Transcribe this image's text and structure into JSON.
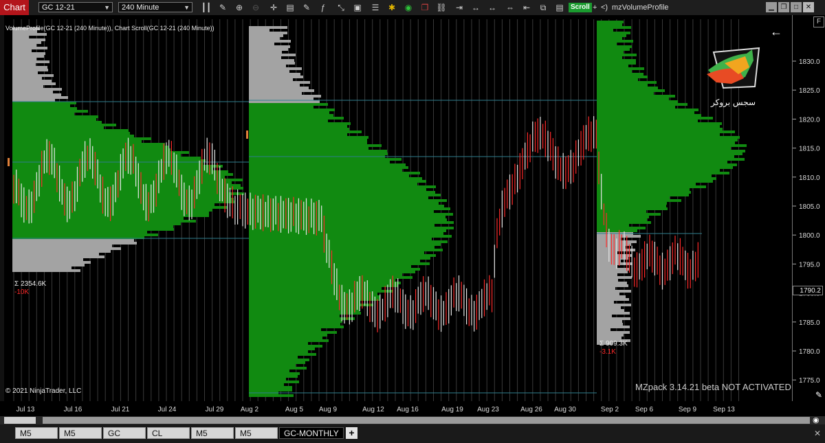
{
  "toolbar": {
    "chart_tab": "Chart",
    "instrument": "GC 12-21",
    "interval": "240 Minute",
    "scroll_label": "Scroll",
    "plus_sign": "+",
    "indicator_arrow": "<)",
    "indicator_name": "mzVolumeProfile"
  },
  "chart": {
    "title": "VolumeProfile(GC 12-21 (240 Minute)), Chart Scroll(GC 12-21 (240 Minute))",
    "copyright": "© 2021 NinjaTrader, LLC",
    "watermark": "MZpack 3.14.21 beta NOT ACTIVATED",
    "logo_caption": "سجس بروكر",
    "profile1_sum": "Σ 2354.6K",
    "profile1_delta": "-10K",
    "profile3_sum": "Σ 909.3K",
    "profile3_delta": "-3.1K",
    "current_price": "1790.2",
    "colors": {
      "value_area": "#118a11",
      "profile_outside": "#a3a3a3",
      "delta_negative": "#ff2a2a",
      "accent_red": "#b3151b"
    }
  },
  "price_axis": {
    "ticks": [
      "1830.0",
      "1825.0",
      "1820.0",
      "1815.0",
      "1810.0",
      "1805.0",
      "1800.0",
      "1795.0",
      "1790.0",
      "1785.0",
      "1780.0",
      "1775.0"
    ]
  },
  "time_axis": {
    "labels": [
      "Jul 13",
      "Jul 16",
      "Jul 21",
      "Jul 24",
      "Jul 29",
      "Aug 2",
      "Aug 5",
      "Aug 9",
      "Aug 12",
      "Aug 16",
      "Aug 19",
      "Aug 23",
      "Aug 26",
      "Aug 30",
      "Sep 2",
      "Sep 6",
      "Sep 9",
      "Sep 13"
    ]
  },
  "tabs": [
    {
      "label": "M5"
    },
    {
      "label": "M5"
    },
    {
      "label": "GC"
    },
    {
      "label": "CL"
    },
    {
      "label": "M5"
    },
    {
      "label": "M5"
    },
    {
      "label": "GC-MONTHLY"
    }
  ],
  "add_tab": "+"
}
